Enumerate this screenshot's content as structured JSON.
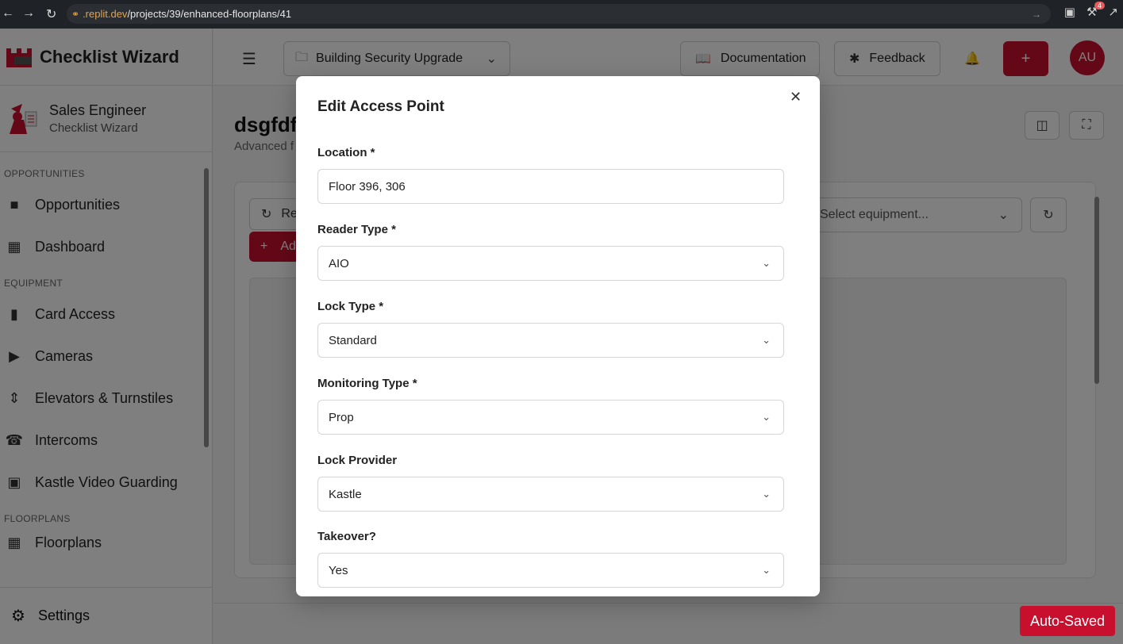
{
  "browser": {
    "url_domain": ".replit.dev",
    "url_path": "/projects/39/enhanced-floorplans/41",
    "badge_count": "4"
  },
  "sidebar": {
    "app_name": "Checklist Wizard",
    "user_name": "Sales Engineer",
    "user_role": "Checklist Wizard",
    "sections": [
      {
        "label": "OPPORTUNITIES",
        "items": [
          {
            "label": "Opportunities",
            "icon": "folder-icon"
          },
          {
            "label": "Dashboard",
            "icon": "dashboard-icon"
          }
        ]
      },
      {
        "label": "EQUIPMENT",
        "items": [
          {
            "label": "Card Access",
            "icon": "door-icon"
          },
          {
            "label": "Cameras",
            "icon": "camera-icon"
          },
          {
            "label": "Elevators & Turnstiles",
            "icon": "elevator-icon"
          },
          {
            "label": "Intercoms",
            "icon": "phone-icon"
          },
          {
            "label": "Kastle Video Guarding",
            "icon": "video-icon"
          }
        ]
      },
      {
        "label": "FLOORPLANS",
        "items": [
          {
            "label": "Floorplans",
            "icon": "map-icon"
          }
        ]
      }
    ],
    "settings_label": "Settings"
  },
  "header": {
    "project": "Building Security Upgrade",
    "documentation": "Documentation",
    "feedback": "Feedback",
    "avatar": "AU"
  },
  "main": {
    "title": "dsgfdf",
    "subtitle": "Advanced f",
    "refresh_label": "Re",
    "add_label": "Ad",
    "equipment_placeholder": "Select equipment..."
  },
  "modal": {
    "title": "Edit Access Point",
    "fields": {
      "location": {
        "label": "Location *",
        "value": "Floor 396, 306"
      },
      "reader_type": {
        "label": "Reader Type *",
        "value": "AIO"
      },
      "lock_type": {
        "label": "Lock Type *",
        "value": "Standard"
      },
      "monitoring_type": {
        "label": "Monitoring Type *",
        "value": "Prop"
      },
      "lock_provider": {
        "label": "Lock Provider",
        "value": "Kastle"
      },
      "takeover": {
        "label": "Takeover?",
        "value": "Yes"
      }
    }
  },
  "autosaved": "Auto-Saved",
  "colors": {
    "brand": "#c8102e",
    "overlay": "rgba(0,0,0,0.5)"
  }
}
